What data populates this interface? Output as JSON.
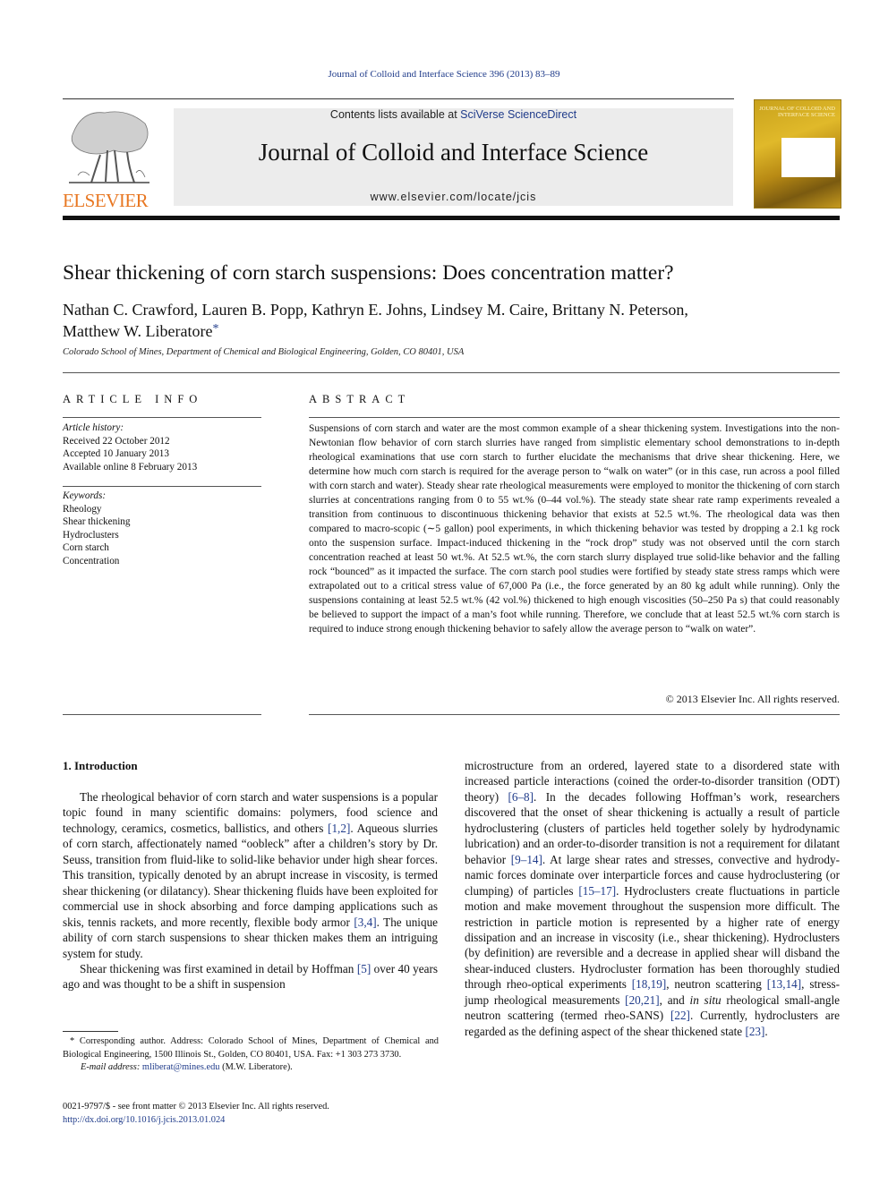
{
  "header": {
    "journal_reference": "Journal of Colloid and Interface Science 396 (2013) 83–89",
    "contents_prefix": "Contents lists available at ",
    "contents_link": "SciVerse ScienceDirect",
    "journal_title": "Journal of Colloid and Interface Science",
    "journal_url": "www.elsevier.com/locate/jcis",
    "publisher_wordmark": "ELSEVIER",
    "cover_title": "JOURNAL OF COLLOID AND INTERFACE SCIENCE",
    "logo_icon": "elsevier-tree-icon",
    "accent_color": "#1f3b8a",
    "publisher_color": "#e87722"
  },
  "article": {
    "title": "Shear thickening of corn starch suspensions: Does concentration matter?",
    "authors_line1": "Nathan C. Crawford, Lauren B. Popp, Kathryn E. Johns, Lindsey M. Caire, Brittany N. Peterson,",
    "authors_line2": "Matthew W. Liberatore",
    "corresponding_mark": "*",
    "affiliation": "Colorado School of Mines, Department of Chemical and Biological Engineering, Golden, CO 80401, USA"
  },
  "article_info": {
    "heading": "ARTICLE INFO",
    "history_label": "Article history:",
    "history": [
      "Received 22 October 2012",
      "Accepted 10 January 2013",
      "Available online 8 February 2013"
    ],
    "keywords_label": "Keywords:",
    "keywords": [
      "Rheology",
      "Shear thickening",
      "Hydroclusters",
      "Corn starch",
      "Concentration"
    ]
  },
  "abstract": {
    "heading": "ABSTRACT",
    "text": "Suspensions of corn starch and water are the most common example of a shear thickening system. Inves­tigations into the non-Newtonian flow behavior of corn starch slurries have ranged from simplistic ele­mentary school demonstrations to in-depth rheological examinations that use corn starch to further elucidate the mechanisms that drive shear thickening. Here, we determine how much corn starch is required for the average person to “walk on water” (or in this case, run across a pool filled with corn starch and water). Steady shear rate rheological measurements were employed to monitor the thickening of corn starch slurries at concentrations ranging from 0 to 55 wt.% (0–44 vol.%). The steady state shear rate ramp experiments revealed a transition from continuous to discontinuous thickening behavior that exists at 52.5 wt.%. The rheological data was then compared to macro-scopic (∼5 gallon) pool experi­ments, in which thickening behavior was tested by dropping a 2.1 kg rock onto the suspension surface. Impact-induced thickening in the “rock drop” study was not observed until the corn starch concentration reached at least 50 wt.%. At 52.5 wt.%, the corn starch slurry displayed true solid-like behavior and the falling rock “bounced” as it impacted the surface. The corn starch pool studies were fortified by steady state stress ramps which were extrapolated out to a critical stress value of 67,000 Pa (i.e., the force gen­erated by an 80 kg adult while running). Only the suspensions containing at least 52.5 wt.% (42 vol.%) thickened to high enough viscosities (50–250 Pa s) that could reasonably be believed to support the impact of a man’s foot while running. Therefore, we conclude that at least 52.5 wt.% corn starch is required to induce strong enough thickening behavior to safely allow the average person to “walk on water”.",
    "copyright": "© 2013 Elsevier Inc. All rights reserved."
  },
  "introduction": {
    "heading": "1. Introduction",
    "p1_parts": [
      "The rheological behavior of corn starch and water suspensions is a popular topic found in many scientific domains: polymers, food science and technology, ceramics, cosmetics, ballistics, and others ",
      "[1,2]",
      ". Aqueous slurries of corn starch, affectionately named “oob­leck” after a children’s story by Dr. Seuss, transition from fluid-like to solid-like behavior under high shear forces. This transition, typ­ically denoted by an abrupt increase in viscosity, is termed shear thickening (or dilatancy). Shear thickening fluids have been exploited for commercial use in shock absorbing and force damp­ing applications such as skis, tennis rackets, and more recently, flexible body armor ",
      "[3,4]",
      ". The unique ability of corn starch suspen­sions to shear thicken makes them an intriguing system for study."
    ],
    "p2_parts": [
      "Shear thickening was first examined in detail by Hoffman ",
      "[5]",
      " over 40 years ago and was thought to be a shift in suspension microstructure from an ordered, layered state to a disordered state with increased particle interactions (coined the order-to-disorder transition (ODT) theory) ",
      "[6–8]",
      ". In the decades following Hoffman’s work, researchers discovered that the onset of shear thickening is actually a result of particle hydroclustering (clusters of particles held together solely by hydrodynamic lubrication) and an order-to-disorder transition is not a requirement for dilatant behavior ",
      "[9–14]",
      ". At large shear rates and stresses, convective and hydrody­namic forces dominate over interparticle forces and cause hydro­clustering (or clumping) of particles ",
      "[15–17]",
      ". Hydroclusters create fluctuations in particle motion and make movement throughout the suspension more difficult. The restriction in parti­cle motion is represented by a higher rate of energy dissipation and an increase in viscosity (i.e., shear thickening). Hydroclusters (by definition) are reversible and a decrease in applied shear will disband the shear-induced clusters. Hydrocluster formation has been thoroughly studied through rheo-optical experiments ",
      "[18,19]",
      ", neutron scattering ",
      "[13,14]",
      ", stress-jump rheological mea­surements ",
      "[20,21]",
      ", and ",
      "in situ",
      " rheological small-angle neutron scattering (termed rheo-SANS) ",
      "[22]",
      ". Currently, hydroclusters are regarded as the defining aspect of the shear thickened state ",
      "[23]",
      "."
    ]
  },
  "footnote": {
    "corresponding": "* Corresponding author. Address: Colorado School of Mines, Department of Chemical and Biological Engineering, 1500 Illinois St., Golden, CO 80401, USA. Fax: +1 303 273 3730.",
    "email_label": "E-mail address:",
    "email": "mliberat@mines.edu",
    "email_suffix": " (M.W. Liberatore).",
    "front_matter": "0021-9797/$ - see front matter © 2013 Elsevier Inc. All rights reserved.",
    "doi": "http://dx.doi.org/10.1016/j.jcis.2013.01.024"
  }
}
